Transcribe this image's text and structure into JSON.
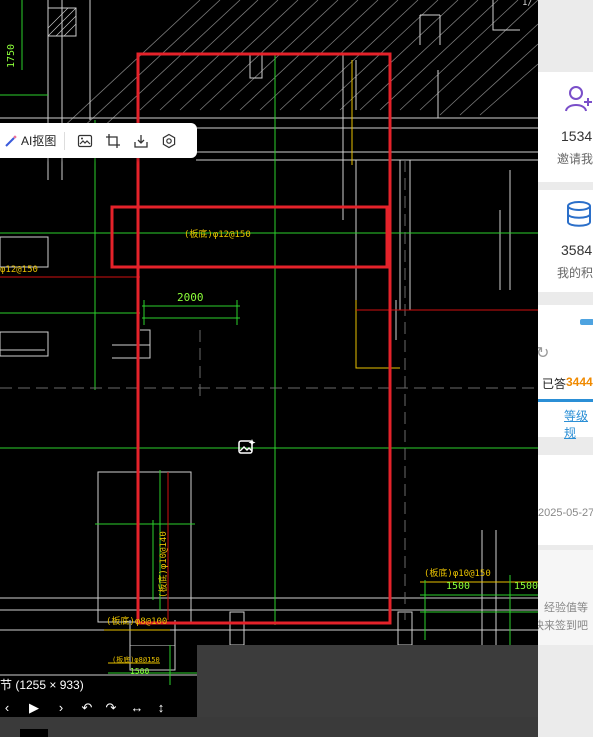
{
  "toolbar": {
    "ai_cutout_label": "AI抠图"
  },
  "drawing": {
    "dim_1750": "1750",
    "dim_2000": "2000",
    "dim_1500_a": "1500",
    "dim_1500_b": "1500",
    "dim_1500_c": "1500",
    "rebar_top": "(板底)φ12@150",
    "rebar_left": "φ12@150",
    "rebar_vertical": "(板底)φ10@140",
    "rebar_bottom_left": "(板底)φ8@100",
    "rebar_bottom_small": "(板底)φ8@150",
    "rebar_right": "(板底)φ10@150",
    "corner_mark": "1/"
  },
  "image_info": {
    "caption": "节 (1255 × 933)"
  },
  "side_panel": {
    "invite_count": "1534",
    "invite_label": "邀请我",
    "points_count": "3584",
    "points_label": "我的积",
    "answered_label": "已答",
    "answered_count": "3444",
    "level_label": "等级规",
    "date": "2025-05-27",
    "exp_line1": "经验值等",
    "exp_line2": "快来签到吧"
  },
  "colors": {
    "highlight_red": "#e5222a",
    "cad_green": "#2bd12b",
    "cad_yellow": "#e8c000",
    "accent_blue": "#2b8fd6",
    "answered_orange": "#f08a00"
  }
}
